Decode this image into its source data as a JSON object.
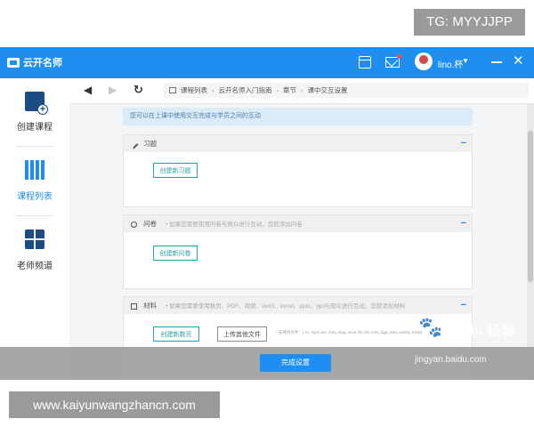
{
  "overlay": {
    "tg_badge": "TG: MYYJJPP",
    "site_badge": "www.kaiyunwangzhancn.com",
    "watermark_brand": "Bai du 经验",
    "watermark_url": "jingyan.baidu.com"
  },
  "titlebar": {
    "app_name": "云开名师",
    "username": "lino.杯",
    "icons": [
      "calendar-icon",
      "mail-icon",
      "avatar",
      "minimize-icon",
      "close-icon"
    ],
    "bg_color": "#1e8ff0"
  },
  "sidebar": {
    "items": [
      {
        "label": "创建课程",
        "icon": "create-course-icon",
        "active": false
      },
      {
        "label": "课程列表",
        "icon": "course-list-icon",
        "active": true
      },
      {
        "label": "老师频道",
        "icon": "teacher-channel-icon",
        "active": false
      }
    ],
    "active_color": "#1e8ff0"
  },
  "toolbar": {
    "back": "◀",
    "forward": "▶",
    "refresh": "↻",
    "breadcrumb": [
      "课程列表",
      "云开名师入门指南",
      "章节",
      "课中交互设置"
    ]
  },
  "content": {
    "info_text": "您可以在上课中使用交互完成与学员之间的互动",
    "panels": [
      {
        "title": "习题",
        "hint": "",
        "buttons": [
          "创建新习题"
        ]
      },
      {
        "title": "问卷",
        "hint": "• 如果您需要使用问卷与观众进行互动，您就添加问卷",
        "buttons": [
          "创建新问卷"
        ]
      },
      {
        "title": "材料",
        "hint": "• 如果您需要使用数页、PDF、视频、word、excel、pptx、ppt与观众进行互动，您就添加材料",
        "buttons": [
          "创建新数页",
          "上传其他文件"
        ],
        "file_hint": "*支持的文件：(.zz,.mp4,.avi,.mov,.mpg,.wmv,.flv,.f4v,.m4v,.3gp,.mkv,.webm,.rmvb)"
      }
    ],
    "collapse_symbol": "−"
  },
  "footer": {
    "done_label": "完成设置"
  }
}
